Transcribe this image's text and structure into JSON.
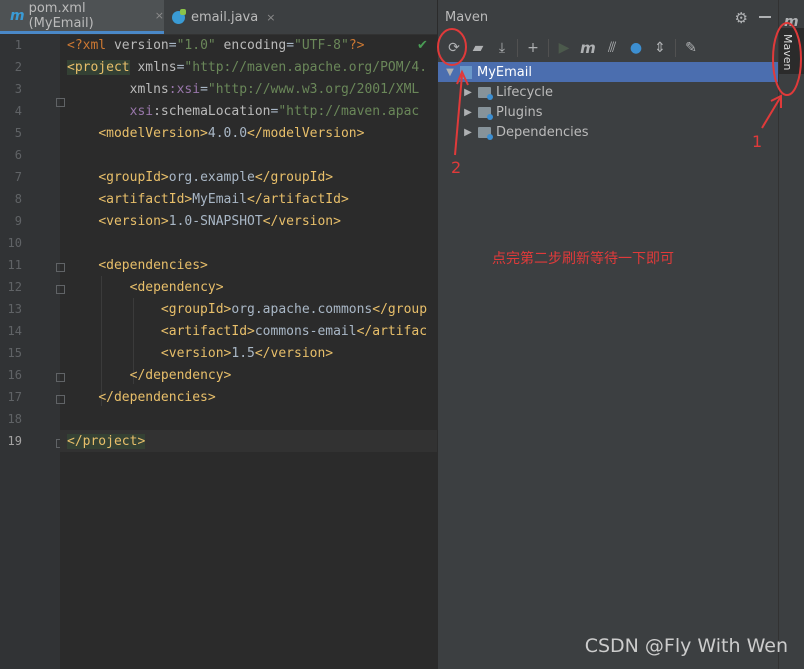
{
  "tabs": [
    {
      "label": "pom.xml (MyEmail)",
      "icon": "maven-file-icon"
    },
    {
      "label": "email.java",
      "icon": "java-file-icon"
    }
  ],
  "close_glyph": "×",
  "line_numbers": [
    "1",
    "2",
    "3",
    "4",
    "5",
    "6",
    "7",
    "8",
    "9",
    "10",
    "11",
    "12",
    "13",
    "14",
    "15",
    "16",
    "17",
    "18",
    "19"
  ],
  "code": {
    "l1_decl": "<?xml ",
    "l1_a1": "version",
    "l1_eq1": "=",
    "l1_v1": "\"1.0\"",
    "l1_a2": " encoding",
    "l1_eq2": "=",
    "l1_v2": "\"UTF-8\"",
    "l1_end": "?>",
    "l2_tag": "<project",
    "l2_attr": " xmlns",
    "l2_eq": "=",
    "l2_val": "\"http://maven.apache.org/POM/4.",
    "l3_attr": "xmlns",
    "l3_ns": ":xsi",
    "l3_eq": "=",
    "l3_val": "\"http://www.w3.org/2001/XML",
    "l4_ns": "xsi",
    "l4_attr": ":schemaLocation",
    "l4_eq": "=",
    "l4_val": "\"http://maven.apac",
    "l5_open": "<modelVersion>",
    "l5_text": "4.0.0",
    "l5_close": "</modelVersion>",
    "l7_open": "<groupId>",
    "l7_text": "org.example",
    "l7_close": "</groupId>",
    "l8_open": "<artifactId>",
    "l8_text": "MyEmail",
    "l8_close": "</artifactId>",
    "l9_open": "<version>",
    "l9_text": "1.0-SNAPSHOT",
    "l9_close": "</version>",
    "l11": "<dependencies>",
    "l12": "<dependency>",
    "l13_open": "<groupId>",
    "l13_text": "org.apache.commons",
    "l13_close": "</group",
    "l14_open": "<artifactId>",
    "l14_text": "commons-email",
    "l14_close": "</artifac",
    "l15_open": "<version>",
    "l15_text": "1.5",
    "l15_close": "</version>",
    "l16": "</dependency>",
    "l17": "</dependencies>",
    "l19": "</project>"
  },
  "maven": {
    "title": "Maven",
    "toolbar": [
      "reload-icon",
      "add-folder-icon",
      "download-icon",
      "plus-icon",
      "run-icon",
      "maven-m-icon",
      "toggle-offline-icon",
      "skip-tests-icon",
      "collapse-icon",
      "wrench-icon"
    ],
    "tree": [
      {
        "label": "MyEmail",
        "expanded": true,
        "selected": true
      },
      {
        "label": "Lifecycle"
      },
      {
        "label": "Plugins"
      },
      {
        "label": "Dependencies"
      }
    ],
    "side_label": "Maven"
  },
  "annotations": {
    "num1": "1",
    "num2": "2",
    "note": "点完第二步刷新等待一下即可",
    "color": "#e03a3a"
  },
  "watermark": "CSDN @Fly With Wen"
}
